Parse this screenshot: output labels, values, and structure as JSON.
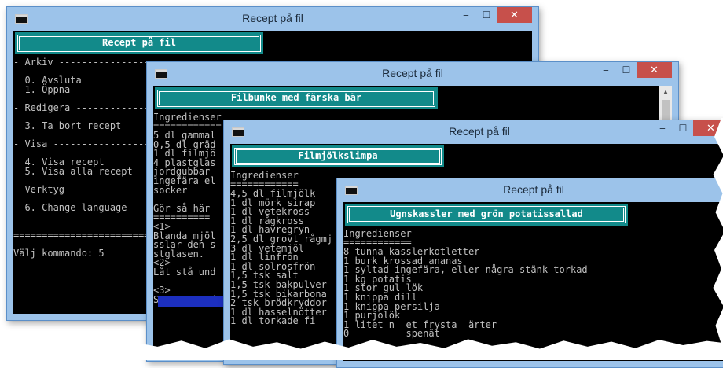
{
  "window1": {
    "title": "Recept på fil",
    "banner": "Recept på fil",
    "lines": [
      "",
      "",
      "",
      "- Arkiv ---------------------",
      "",
      "  0. Avsluta",
      "  1. Öppna",
      "",
      "- Redigera ------------------",
      "",
      "  3. Ta bort recept",
      "",
      "- Visa ----------------------",
      "",
      "  4. Visa recept",
      "  5. Visa alla recept",
      "",
      "- Verktyg -------------------",
      "",
      "  6. Change language",
      "",
      "",
      "==========================",
      "",
      "Välj kommando: 5"
    ]
  },
  "window2": {
    "title": "Recept på fil",
    "banner": "Filbunke med färska bär",
    "lines": [
      "",
      "",
      "",
      "Ingredienser",
      "============",
      "5 dl gammal",
      "0,5 dl gräd",
      "1 dl filmjö",
      "4 plastglas",
      "jordgubbar",
      "ingefära el",
      "socker",
      "",
      "Gör så här",
      "==========",
      "<1>",
      "Blanda mjöl",
      "sslar den s",
      "stglasen.",
      "<2>",
      "Låt stå und",
      "",
      "<3>",
      "Servera med"
    ]
  },
  "window3": {
    "title": "Recept på fil",
    "banner": "Filmjölkslimpa",
    "lines": [
      "",
      "",
      "",
      "Ingredienser",
      "============",
      "4,5 dl filmjölk",
      "1 dl mörk sirap",
      "1 dl vetekross",
      "1 dl rågkross",
      "1 dl havregryn",
      "2,5 dl grovt rågmj",
      "3 dl vetemjöl",
      "1 dl linfrön",
      "1 dl solrosfrön",
      "1,5 tsk salt",
      "1,5 tsk bakpulver",
      "1,5 tsk bikarbona",
      "2 tsk brödkryddor",
      "1 dl hasselnötter",
      "1 dl torkade fi"
    ]
  },
  "window4": {
    "title": "Recept på fil",
    "banner": "Ugnskassler med grön potatissallad",
    "lines": [
      "",
      "",
      "",
      "Ingredienser",
      "============",
      "8 tunna kasslerkotletter",
      "1 burk krossad ananas",
      "1 syltad ingefära, eller några stänk torkad",
      "1 kg potatis",
      "1 stor gul lök",
      "1 knippa dill",
      "1 knippa persilja",
      "1 purjolök",
      "1 litet n  et frysta  ärter",
      "0          spenät"
    ]
  },
  "controls": {
    "minimize": "‒",
    "maximize": "☐",
    "close": "✕"
  }
}
